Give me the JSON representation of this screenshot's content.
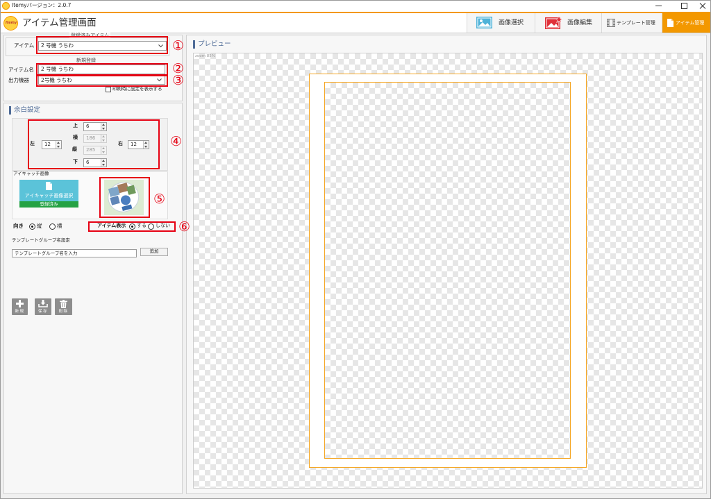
{
  "window": {
    "title": "Itemyバージョン：2.0.7"
  },
  "header": {
    "logo_text": "Itemy",
    "title": "アイテム管理画面",
    "tabs": [
      {
        "label": "画像選択",
        "icon": "image-icon",
        "active": false
      },
      {
        "label": "画像編集",
        "icon": "image-edit-icon",
        "active": false
      },
      {
        "label": "テンプレート管理",
        "icon": "film-icon",
        "active": false
      },
      {
        "label": "アイテム管理",
        "icon": "document-icon",
        "active": true
      }
    ]
  },
  "registered_items": {
    "group_label": "登録済みアイテム",
    "item_label": "アイテム",
    "item_selected": "2 号機 うちわ"
  },
  "new_registration": {
    "group_label": "新規登録",
    "name_label": "アイテム名",
    "name_value": "2 号機 うちわ",
    "device_label": "出力機器",
    "device_selected": "2号機 うちわ",
    "show_settings_label": "印刷時に設定を表示する",
    "show_settings_checked": false
  },
  "margin_settings": {
    "title": "余白設定",
    "top": {
      "label": "上",
      "value": "6"
    },
    "width": {
      "label": "横",
      "value": "186",
      "enabled": false
    },
    "height": {
      "label": "縦",
      "value": "285",
      "enabled": false
    },
    "bottom": {
      "label": "下",
      "value": "6"
    },
    "left": {
      "label": "左",
      "value": "12"
    },
    "right": {
      "label": "右",
      "value": "12"
    }
  },
  "eyecatch": {
    "label": "アイキャッチ画像",
    "select_button": "アイキャッチ画像選択",
    "status": "登録済み"
  },
  "orientation": {
    "label": "向き",
    "options": [
      "縦",
      "横"
    ],
    "selected": "縦"
  },
  "item_display": {
    "label": "アイテム表示",
    "options": [
      "する",
      "しない"
    ],
    "selected": "する"
  },
  "template_group": {
    "label": "テンプレートグループ名設定",
    "input_value": "テンプレートグループ名を入力",
    "add_button": "追加"
  },
  "actions": [
    {
      "label": "新規",
      "icon": "plus-icon"
    },
    {
      "label": "保存",
      "icon": "save-icon"
    },
    {
      "label": "削除",
      "icon": "trash-icon"
    }
  ],
  "preview": {
    "title": "プレビュー",
    "zoom": "zoom 85%"
  },
  "annotations": [
    "①",
    "②",
    "③",
    "④",
    "⑤",
    "⑥"
  ],
  "colors": {
    "accent_orange": "#f39800",
    "annotation_red": "#e60012",
    "eyecatch_button": "#5bc3d9",
    "registered_green": "#25a244",
    "section_heading": "#4d6a96"
  }
}
